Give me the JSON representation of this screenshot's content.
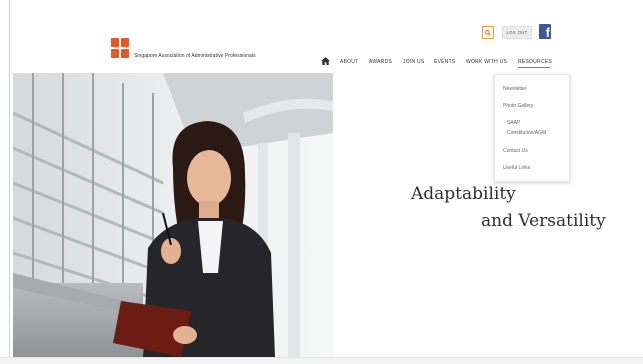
{
  "header": {
    "org_name": "Singapore Association of Administrative Professionals",
    "login_label": "LOG OUT",
    "facebook_glyph": "f"
  },
  "nav": {
    "items": [
      "ABOUT",
      "AWARDS",
      "JOIN US",
      "EVENTS",
      "WORK WITH US",
      "RESOURCES"
    ],
    "active": "RESOURCES"
  },
  "dropdown": {
    "items": [
      "Newsletter",
      "Photo Gallery",
      "SAAP",
      "Constitution/AGM",
      "Contact Us",
      "Useful Links"
    ]
  },
  "hero": {
    "tagline_line1": "Adaptability",
    "tagline_line2": "and Versatility"
  },
  "colors": {
    "accent": "#e8571f",
    "search_border": "#f0a23a",
    "facebook": "#3b5998"
  },
  "icons": [
    "logo-mark",
    "search-icon",
    "facebook-icon",
    "home-icon"
  ]
}
